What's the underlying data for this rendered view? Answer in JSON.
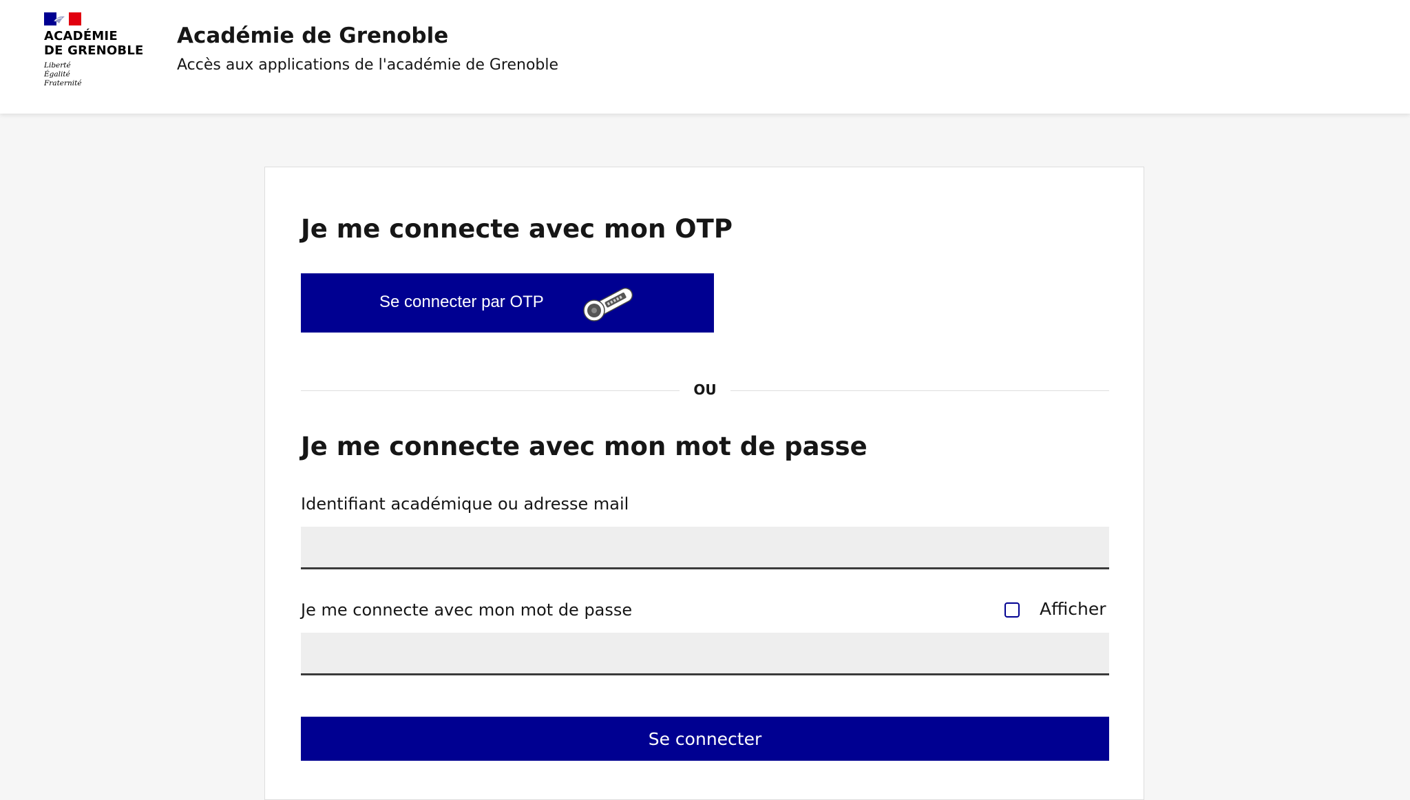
{
  "header": {
    "logo": {
      "line1": "ACADÉMIE",
      "line2": "DE GRENOBLE",
      "motto": [
        "Liberté",
        "Égalité",
        "Fraternité"
      ]
    },
    "title": "Académie de Grenoble",
    "subtitle": "Accès aux applications de l'académie de Grenoble"
  },
  "colors": {
    "primary": "#000091",
    "flag_blue": "#000091",
    "flag_red": "#e1000f",
    "input_bg": "#eeeeee"
  },
  "otp": {
    "heading": "Je me connecte avec mon OTP",
    "button_label": "Se connecter par OTP",
    "icon": "otp-key-icon"
  },
  "divider": {
    "text": "OU"
  },
  "password_login": {
    "heading": "Je me connecte avec mon mot de passe",
    "identifier_label": "Identifiant académique ou adresse mail",
    "identifier_value": "",
    "password_label": "Je me connecte avec mon mot de passe",
    "password_value": "",
    "show_label": "Afficher",
    "show_checked": false,
    "submit_label": "Se connecter"
  }
}
